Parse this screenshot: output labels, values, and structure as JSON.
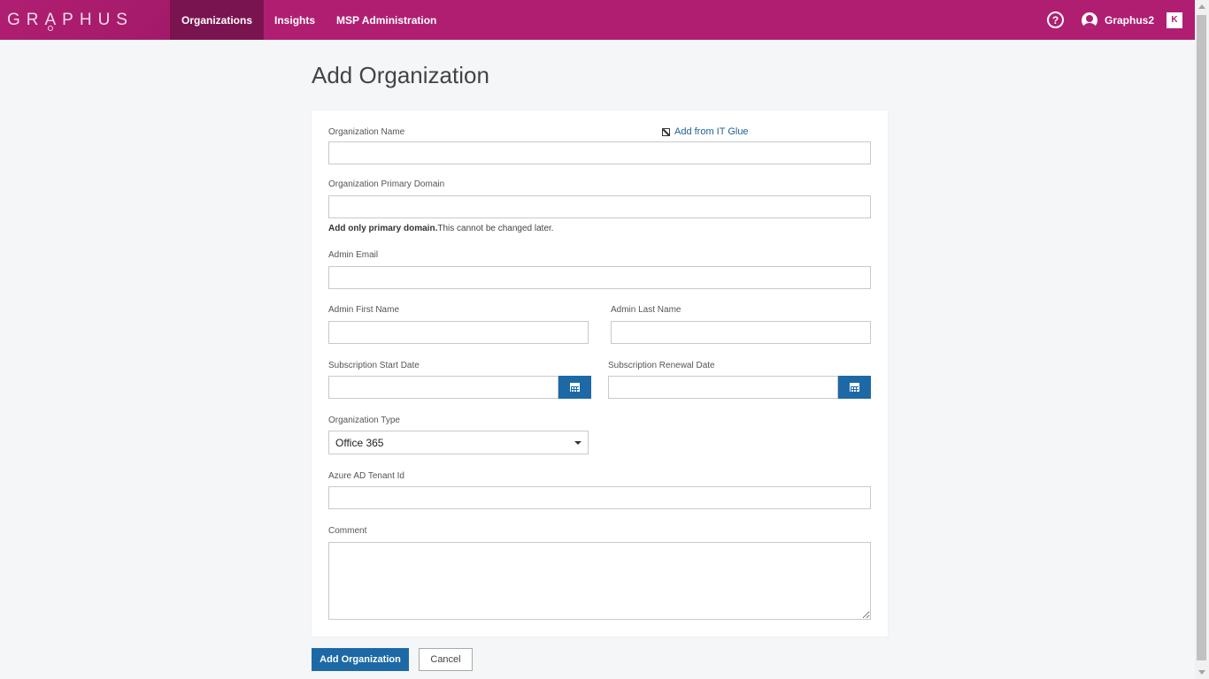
{
  "app": {
    "logo_text": "GRAPHUS"
  },
  "nav": {
    "items": [
      {
        "label": "Organizations"
      },
      {
        "label": "Insights"
      },
      {
        "label": "MSP Administration"
      }
    ],
    "help_icon": "question-circle-icon",
    "user_icon": "user-circle-icon",
    "username": "Graphus2",
    "badge_text": "K",
    "accent_color": "#b01e72"
  },
  "page": {
    "title": "Add Organization"
  },
  "form": {
    "org_name_label": "Organization Name",
    "add_from_itglue": "Add from IT Glue",
    "primary_domain_label": "Organization Primary Domain",
    "primary_domain_hint_bold": "Add only primary domain.",
    "primary_domain_hint": "This cannot be changed later.",
    "admin_email_label": "Admin Email",
    "admin_first_name_label": "Admin First Name",
    "admin_last_name_label": "Admin Last Name",
    "sub_start_label": "Subscription Start Date",
    "sub_renewal_label": "Subscription Renewal Date",
    "org_type_label": "Organization Type",
    "org_type_value": "Office 365",
    "azure_tenant_label": "Azure AD Tenant Id",
    "comment_label": "Comment",
    "values": {
      "org_name": "",
      "primary_domain": "",
      "admin_email": "",
      "admin_first_name": "",
      "admin_last_name": "",
      "sub_start": "",
      "sub_renewal": "",
      "azure_tenant": "",
      "comment": ""
    }
  },
  "actions": {
    "submit_label": "Add Organization",
    "cancel_label": "Cancel",
    "primary_color": "#1d69a6"
  }
}
